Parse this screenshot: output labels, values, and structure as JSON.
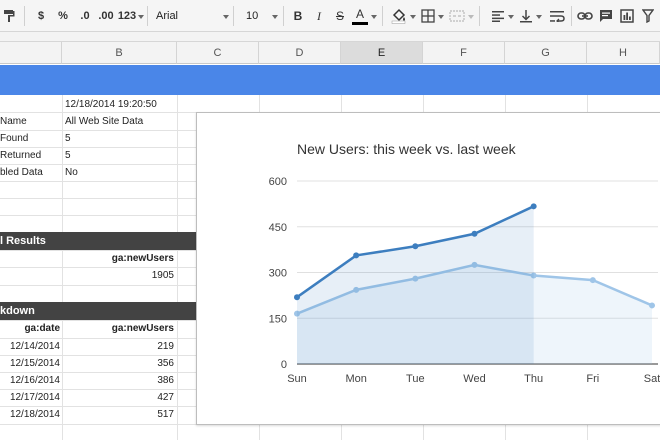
{
  "toolbar": {
    "currency_symbol": "$",
    "percent_symbol": "%",
    "decrease_decimals": ".0",
    "increase_decimals": ".00",
    "more_formats": "123",
    "font_name": "Arial",
    "font_size": "10",
    "bold": "B",
    "italic": "I",
    "strikethrough": "S",
    "text_color": "A"
  },
  "columns": [
    "B",
    "C",
    "D",
    "E",
    "F",
    "G",
    "H"
  ],
  "selected_column": "E",
  "report_info": {
    "run_time": "12/18/2014 19:20:50",
    "rows": [
      {
        "label": "Name",
        "value": "All Web Site Data"
      },
      {
        "label": "Found",
        "value": "5"
      },
      {
        "label": "Returned",
        "value": "5"
      },
      {
        "label": "bled Data",
        "value": "No"
      }
    ]
  },
  "total_results": {
    "title": "l Results",
    "header": "ga:newUsers",
    "value": "1905"
  },
  "breakdown": {
    "title": "kdown",
    "headers": [
      "ga:date",
      "ga:newUsers"
    ],
    "rows": [
      [
        "12/14/2014",
        "219"
      ],
      [
        "12/15/2014",
        "356"
      ],
      [
        "12/16/2014",
        "386"
      ],
      [
        "12/17/2014",
        "427"
      ],
      [
        "12/18/2014",
        "517"
      ]
    ]
  },
  "colors": {
    "accent": "#4a86e8",
    "this_week": "#3d7ebf",
    "last_week": "#9fc5e8",
    "section_bar": "#434343"
  },
  "chart_data": {
    "type": "area",
    "title": "New Users: this week vs. last week",
    "categories": [
      "Sun",
      "Mon",
      "Tue",
      "Wed",
      "Thu",
      "Fri",
      "Sat"
    ],
    "series": [
      {
        "values": [
          219,
          356,
          386,
          427,
          517
        ]
      },
      {
        "values": [
          165,
          243,
          280,
          325,
          290,
          275,
          192
        ]
      }
    ],
    "ylim": [
      0,
      600
    ],
    "yticks": [
      0,
      150,
      300,
      450,
      600
    ],
    "grid": true
  }
}
